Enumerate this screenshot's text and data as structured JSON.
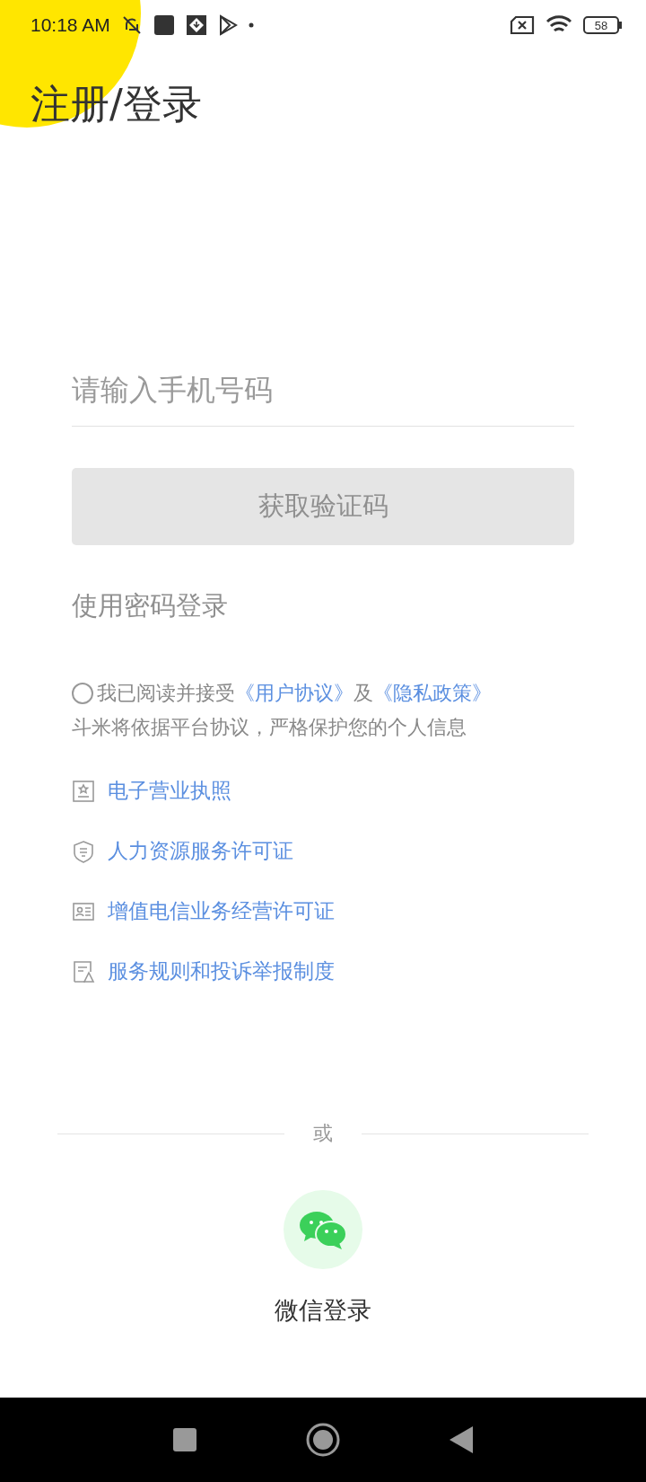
{
  "status_bar": {
    "time": "10:18 AM",
    "battery": "58"
  },
  "title": "注册/登录",
  "phone_field": {
    "placeholder": "请输入手机号码"
  },
  "code_button": {
    "label": "获取验证码",
    "disabled": true
  },
  "password_login": "使用密码登录",
  "agreement": {
    "checked": false,
    "parts": [
      {
        "kind": "text",
        "text": "我已阅读并接受"
      },
      {
        "kind": "link",
        "text": "《用户协议》"
      },
      {
        "kind": "text",
        "text": "及"
      },
      {
        "kind": "link",
        "text": "《隐私政策》"
      }
    ],
    "note": "斗米将依据平台协议，严格保护您的个人信息"
  },
  "licenses": [
    {
      "kind": "certificate",
      "label": "电子营业执照"
    },
    {
      "kind": "shield",
      "label": "人力资源服务许可证"
    },
    {
      "kind": "idcard",
      "label": "增值电信业务经营许可证"
    },
    {
      "kind": "report",
      "label": "服务规则和投诉举报制度"
    }
  ],
  "divider": "或",
  "wechat_login": "微信登录"
}
